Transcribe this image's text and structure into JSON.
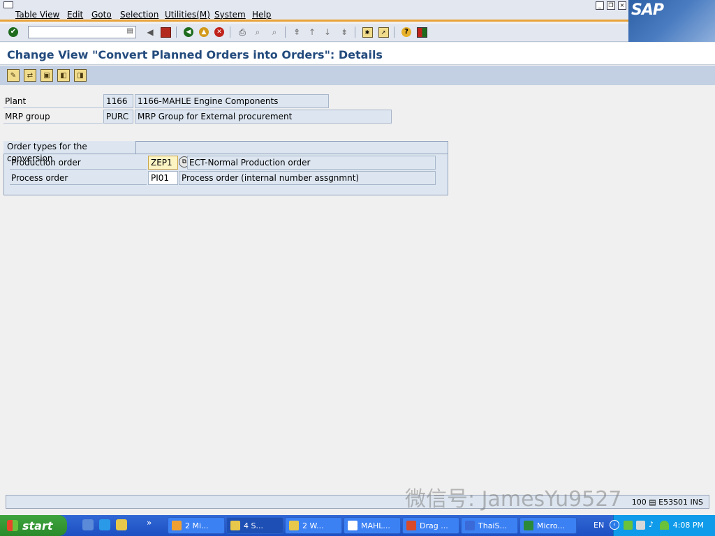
{
  "menu": {
    "items": [
      "Table View",
      "Edit",
      "Goto",
      "Selection",
      "Utilities(M)",
      "System",
      "Help"
    ]
  },
  "window_controls": {
    "minimize": "_",
    "restore": "❐",
    "close": "×"
  },
  "branding": {
    "logo_text": "SAP"
  },
  "toolbar": {
    "command_field_value": ""
  },
  "title": "Change View \"Convert Planned Orders into Orders\": Details",
  "header_fields": {
    "plant_label": "Plant",
    "plant_value": "1166",
    "plant_desc": "1166-MAHLE Engine Components",
    "mrp_label": "MRP group",
    "mrp_value": "PURC",
    "mrp_desc": "MRP Group for External procurement"
  },
  "group": {
    "title": "Order types for the conversion",
    "rows": [
      {
        "label": "Production order",
        "value": "ZEP1",
        "desc": "ECT-Normal Production order"
      },
      {
        "label": "Process order",
        "value": "PI01",
        "desc": "Process order (internal number assgnmnt)"
      }
    ]
  },
  "status_bar": {
    "system_info": "100 ▤  E53S01  INS"
  },
  "watermark": "微信号: JamesYu9527",
  "taskbar": {
    "start_label": "start",
    "tasks": [
      "2 Mi...",
      "4 S...",
      "2 W...",
      "MAHL...",
      "Drag ...",
      "ThaiS...",
      "Micro..."
    ],
    "language": "EN",
    "clock": "4:08 PM"
  },
  "colors": {
    "accent_orange": "#e8a33a",
    "title_blue": "#234b7d",
    "field_bg": "#dde6f0",
    "taskbar_blue": "#1d4fc2"
  }
}
